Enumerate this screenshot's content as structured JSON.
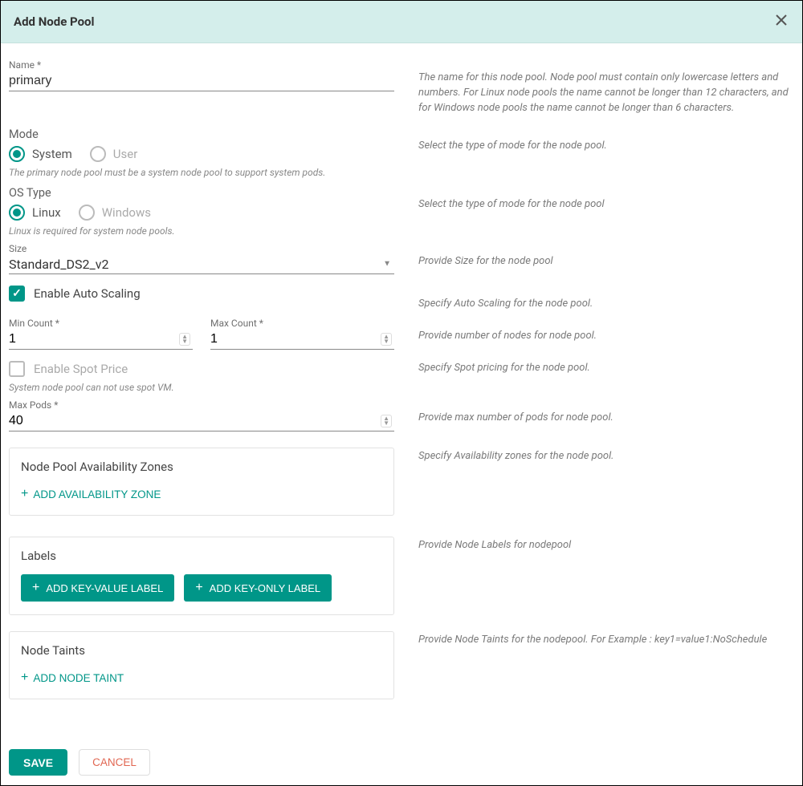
{
  "header": {
    "title": "Add Node Pool"
  },
  "name": {
    "label": "Name *",
    "value": "primary",
    "hint": "The name for this node pool. Node pool must contain only lowercase letters and numbers. For Linux node pools the name cannot be longer than 12 characters, and for Windows node pools the name cannot be longer than 6 characters."
  },
  "mode": {
    "label": "Mode",
    "options": {
      "system": "System",
      "user": "User"
    },
    "helper": "The primary node pool must be a system node pool to support system pods.",
    "hint": "Select the type of mode for the node pool."
  },
  "os": {
    "label": "OS Type",
    "options": {
      "linux": "Linux",
      "windows": "Windows"
    },
    "helper": "Linux is required for system node pools.",
    "hint": "Select the type of mode for the node pool"
  },
  "size": {
    "label": "Size",
    "value": "Standard_DS2_v2",
    "hint": "Provide Size for the node pool"
  },
  "autoscale": {
    "label": "Enable Auto Scaling",
    "hint": "Specify Auto Scaling for the node pool."
  },
  "min": {
    "label": "Min Count *",
    "value": "1"
  },
  "max": {
    "label": "Max Count *",
    "value": "1"
  },
  "counts_hint": "Provide number of nodes for node pool.",
  "spot": {
    "label": "Enable Spot Price",
    "hint": "Specify Spot pricing for the node pool.",
    "helper": "System node pool can not use spot VM."
  },
  "maxpods": {
    "label": "Max Pods *",
    "value": "40",
    "hint": "Provide max number of pods for node pool."
  },
  "zones": {
    "title": "Node Pool Availability Zones",
    "add": "ADD  AVAILABILITY ZONE",
    "hint": "Specify Availability zones for the node pool."
  },
  "labels": {
    "title": "Labels",
    "kv": "ADD KEY-VALUE LABEL",
    "k": "ADD KEY-ONLY LABEL",
    "hint": "Provide Node Labels for nodepool"
  },
  "taints": {
    "title": "Node Taints",
    "add": "ADD  NODE TAINT",
    "hint": "Provide Node Taints for the nodepool. For Example : key1=value1:NoSchedule"
  },
  "footer": {
    "save": "SAVE",
    "cancel": "CANCEL"
  },
  "glyphs": {
    "plus": "+"
  }
}
